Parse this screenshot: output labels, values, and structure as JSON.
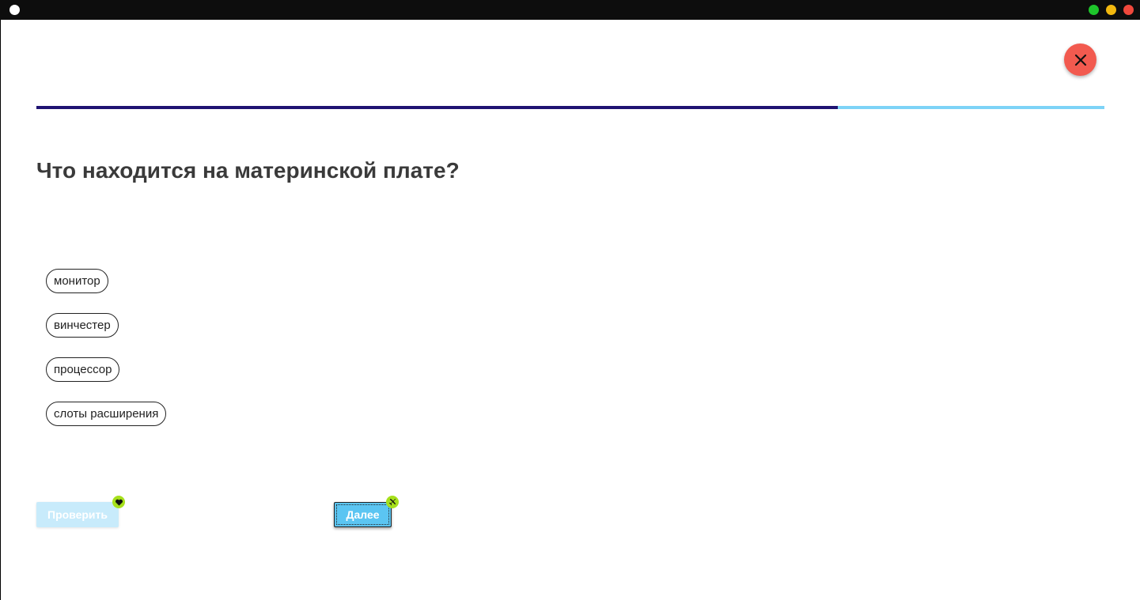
{
  "colors": {
    "titlebar": "#0d0d0d",
    "close_button": "#f25a4f",
    "progress_filled": "#1f1372",
    "progress_track": "#7dd3f7",
    "check_button_disabled": "#c8ebfb",
    "next_button": "#5bc5f2",
    "badge": "#a6e01c"
  },
  "window": {
    "controls": [
      "green-dot",
      "yellow-dot",
      "red-dot"
    ]
  },
  "quiz": {
    "close_icon": "close-icon",
    "progress": 0.75,
    "question": "Что находится на материнской плате?",
    "options": [
      {
        "label": "монитор"
      },
      {
        "label": "винчестер"
      },
      {
        "label": "процессор"
      },
      {
        "label": "слоты расширения"
      }
    ],
    "check_label": "Проверить",
    "check_badge_icon": "heart-icon",
    "next_label": "Далее",
    "next_badge_icon": "airplane-icon"
  }
}
